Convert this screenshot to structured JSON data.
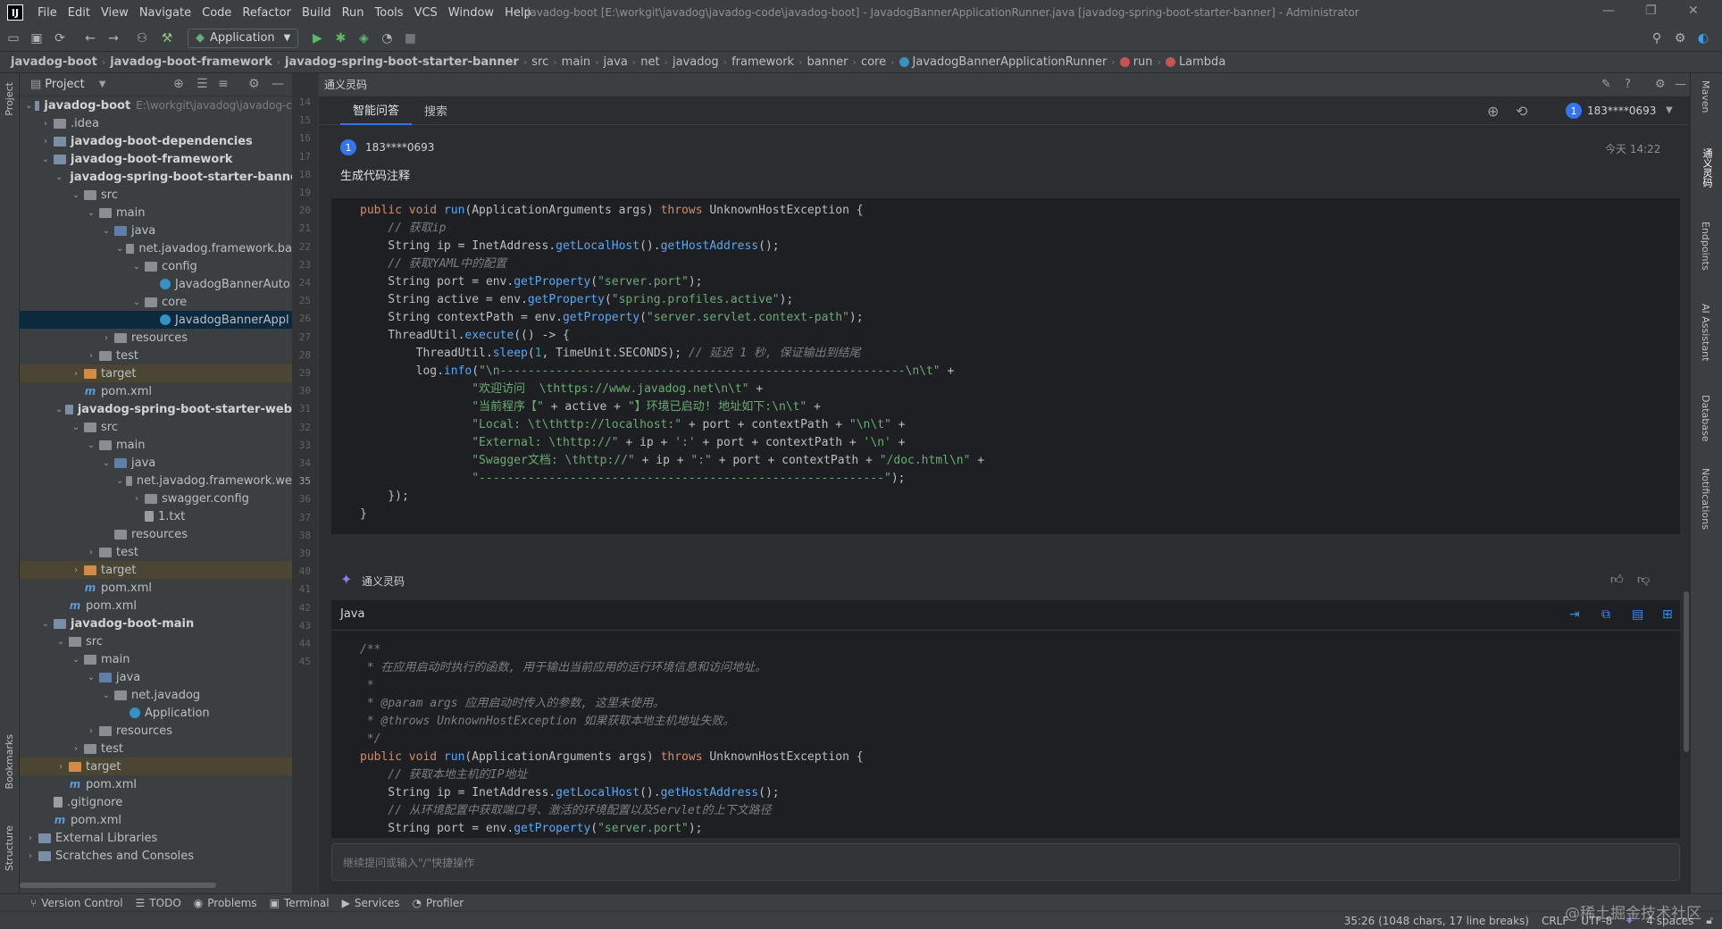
{
  "menubar": {
    "items": [
      "File",
      "Edit",
      "View",
      "Navigate",
      "Code",
      "Refactor",
      "Build",
      "Run",
      "Tools",
      "VCS",
      "Window",
      "Help"
    ],
    "title": "javadog-boot [E:\\workgit\\javadog\\javadog-code\\javadog-boot] - JavadogBannerApplicationRunner.java [javadog-spring-boot-starter-banner] - Administrator"
  },
  "toolbar": {
    "run_config": "Application"
  },
  "breadcrumb": [
    "javadog-boot",
    "javadog-boot-framework",
    "javadog-spring-boot-starter-banner",
    "src",
    "main",
    "java",
    "net",
    "javadog",
    "framework",
    "banner",
    "core",
    "JavadogBannerApplicationRunner",
    "run",
    "Lambda"
  ],
  "project_panel": {
    "title": "Project",
    "tree": [
      {
        "label": "javadog-boot",
        "hint": "E:\\workgit\\javadog\\javadog-c",
        "indent": 0,
        "arrow": "down",
        "icon": "mod",
        "bold": true
      },
      {
        "label": ".idea",
        "indent": 1,
        "arrow": "right",
        "icon": "folder"
      },
      {
        "label": "javadog-boot-dependencies",
        "indent": 1,
        "arrow": "right",
        "icon": "mod",
        "bold": true
      },
      {
        "label": "javadog-boot-framework",
        "indent": 1,
        "arrow": "down",
        "icon": "mod",
        "bold": true
      },
      {
        "label": "javadog-spring-boot-starter-banner",
        "indent": 2,
        "arrow": "down",
        "icon": "mod",
        "bold": true
      },
      {
        "label": "src",
        "indent": 3,
        "arrow": "down",
        "icon": "folder"
      },
      {
        "label": "main",
        "indent": 4,
        "arrow": "down",
        "icon": "folder"
      },
      {
        "label": "java",
        "indent": 5,
        "arrow": "down",
        "icon": "src"
      },
      {
        "label": "net.javadog.framework.ba",
        "indent": 6,
        "arrow": "down",
        "icon": "folder"
      },
      {
        "label": "config",
        "indent": 7,
        "arrow": "down",
        "icon": "folder"
      },
      {
        "label": "JavadogBannerAuto",
        "indent": 8,
        "arrow": "",
        "icon": "cls"
      },
      {
        "label": "core",
        "indent": 7,
        "arrow": "down",
        "icon": "folder"
      },
      {
        "label": "JavadogBannerAppl",
        "indent": 8,
        "arrow": "",
        "icon": "cls",
        "selected": true
      },
      {
        "label": "resources",
        "indent": 5,
        "arrow": "right",
        "icon": "res"
      },
      {
        "label": "test",
        "indent": 4,
        "arrow": "right",
        "icon": "folder"
      },
      {
        "label": "target",
        "indent": 3,
        "arrow": "right",
        "icon": "tgtf",
        "target": true
      },
      {
        "label": "pom.xml",
        "indent": 3,
        "arrow": "",
        "icon": "pom"
      },
      {
        "label": "javadog-spring-boot-starter-web",
        "indent": 2,
        "arrow": "down",
        "icon": "mod",
        "bold": true
      },
      {
        "label": "src",
        "indent": 3,
        "arrow": "down",
        "icon": "folder"
      },
      {
        "label": "main",
        "indent": 4,
        "arrow": "down",
        "icon": "folder"
      },
      {
        "label": "java",
        "indent": 5,
        "arrow": "down",
        "icon": "src"
      },
      {
        "label": "net.javadog.framework.we",
        "indent": 6,
        "arrow": "down",
        "icon": "folder"
      },
      {
        "label": "swagger.config",
        "indent": 7,
        "arrow": "right",
        "icon": "folder"
      },
      {
        "label": "1.txt",
        "indent": 7,
        "arrow": "",
        "icon": "txt"
      },
      {
        "label": "resources",
        "indent": 5,
        "arrow": "",
        "icon": "res"
      },
      {
        "label": "test",
        "indent": 4,
        "arrow": "right",
        "icon": "folder"
      },
      {
        "label": "target",
        "indent": 3,
        "arrow": "right",
        "icon": "tgtf",
        "target": true
      },
      {
        "label": "pom.xml",
        "indent": 3,
        "arrow": "",
        "icon": "pom"
      },
      {
        "label": "pom.xml",
        "indent": 2,
        "arrow": "",
        "icon": "pom"
      },
      {
        "label": "javadog-boot-main",
        "indent": 1,
        "arrow": "down",
        "icon": "mod",
        "bold": true
      },
      {
        "label": "src",
        "indent": 2,
        "arrow": "down",
        "icon": "folder"
      },
      {
        "label": "main",
        "indent": 3,
        "arrow": "down",
        "icon": "folder"
      },
      {
        "label": "java",
        "indent": 4,
        "arrow": "down",
        "icon": "src"
      },
      {
        "label": "net.javadog",
        "indent": 5,
        "arrow": "down",
        "icon": "folder"
      },
      {
        "label": "Application",
        "indent": 6,
        "arrow": "",
        "icon": "cls"
      },
      {
        "label": "resources",
        "indent": 4,
        "arrow": "right",
        "icon": "res"
      },
      {
        "label": "test",
        "indent": 3,
        "arrow": "right",
        "icon": "folder"
      },
      {
        "label": "target",
        "indent": 2,
        "arrow": "right",
        "icon": "tgtf",
        "target": true
      },
      {
        "label": "pom.xml",
        "indent": 2,
        "arrow": "",
        "icon": "pom"
      },
      {
        "label": ".gitignore",
        "indent": 1,
        "arrow": "",
        "icon": "txt"
      },
      {
        "label": "pom.xml",
        "indent": 1,
        "arrow": "",
        "icon": "pom"
      },
      {
        "label": "External Libraries",
        "indent": 0,
        "arrow": "right",
        "icon": "lib"
      },
      {
        "label": "Scratches and Consoles",
        "indent": 0,
        "arrow": "right",
        "icon": "lib"
      }
    ]
  },
  "gutter": {
    "lines": [
      "14",
      "15",
      "16",
      "17",
      "18",
      "19",
      "20",
      "21",
      "22",
      "23",
      "24",
      "25",
      "26",
      "27",
      "28",
      "29",
      "30",
      "31",
      "32",
      "33",
      "34",
      "35",
      "36",
      "37",
      "38",
      "39",
      "40",
      "41",
      "42",
      "43",
      "44",
      "45"
    ],
    "current": "35"
  },
  "left_vertical_tabs": [
    "Project",
    "Bookmarks",
    "Structure"
  ],
  "right_vertical_tabs": [
    "Maven",
    "通义灵码",
    "Endpoints",
    "AI Assistant",
    "Database",
    "Notifications"
  ],
  "tongyi": {
    "panel_title": "通义灵码",
    "tabs": [
      "智能问答",
      "搜索"
    ],
    "user": "183****0693",
    "question": {
      "user": "183****0693",
      "time": "今天 14:22",
      "text": "生成代码注释"
    },
    "question_code": [
      [
        [
          "kw",
          "public void "
        ],
        [
          "fn",
          "run"
        ],
        [
          "",
          "(ApplicationArguments args) "
        ],
        [
          "kw",
          "throws "
        ],
        [
          "",
          "UnknownHostException {"
        ]
      ],
      [
        [
          "cm",
          "    // 获取ip"
        ]
      ],
      [
        [
          "",
          "    String ip = InetAddress."
        ],
        [
          "fn",
          "getLocalHost"
        ],
        [
          "",
          "()."
        ],
        [
          "fn",
          "getHostAddress"
        ],
        [
          "",
          "();"
        ]
      ],
      [
        [
          "cm",
          "    // 获取YAML中的配置"
        ]
      ],
      [
        [
          "",
          "    String port = env."
        ],
        [
          "fn",
          "getProperty"
        ],
        [
          "",
          "("
        ],
        [
          "str",
          "\"server.port\""
        ],
        [
          "",
          ");"
        ]
      ],
      [
        [
          "",
          "    String active = env."
        ],
        [
          "fn",
          "getProperty"
        ],
        [
          "",
          "("
        ],
        [
          "str",
          "\"spring.profiles.active\""
        ],
        [
          "",
          ");"
        ]
      ],
      [
        [
          "",
          "    String contextPath = env."
        ],
        [
          "fn",
          "getProperty"
        ],
        [
          "",
          "("
        ],
        [
          "str",
          "\"server.servlet.context-path\""
        ],
        [
          "",
          ");"
        ]
      ],
      [
        [
          "",
          "    ThreadUtil."
        ],
        [
          "fn",
          "execute"
        ],
        [
          "",
          "(() -> {"
        ]
      ],
      [
        [
          "",
          "        ThreadUtil."
        ],
        [
          "fn",
          "sleep"
        ],
        [
          "",
          "("
        ],
        [
          "num",
          "1"
        ],
        [
          "",
          ", TimeUnit.SECONDS); "
        ],
        [
          "cm",
          "// 延迟 1 秒, 保证输出到结尾"
        ]
      ],
      [
        [
          "",
          "        log."
        ],
        [
          "fn",
          "info"
        ],
        [
          "",
          "("
        ],
        [
          "str",
          "\"\\n----------------------------------------------------------\\n\\t\""
        ],
        [
          "",
          " +"
        ]
      ],
      [
        [
          "str",
          "                \"欢迎访问  \\thttps://www.javadog.net\\n\\t\""
        ],
        [
          "",
          " +"
        ]
      ],
      [
        [
          "str",
          "                \"当前程序【\""
        ],
        [
          "",
          " + active + "
        ],
        [
          "str",
          "\"】环境已启动! 地址如下:\\n\\t\""
        ],
        [
          "",
          " +"
        ]
      ],
      [
        [
          "str",
          "                \"Local: \\t\\thttp://localhost:\""
        ],
        [
          "",
          " + port + contextPath + "
        ],
        [
          "str",
          "\"\\n\\t\""
        ],
        [
          "",
          " +"
        ]
      ],
      [
        [
          "str",
          "                \"External: \\thttp://\""
        ],
        [
          "",
          " + ip + "
        ],
        [
          "str",
          "':'"
        ],
        [
          "",
          " + port + contextPath + "
        ],
        [
          "str",
          "'\\n'"
        ],
        [
          "",
          " +"
        ]
      ],
      [
        [
          "str",
          "                \"Swagger文档: \\thttp://\""
        ],
        [
          "",
          " + ip + "
        ],
        [
          "str",
          "\":\""
        ],
        [
          "",
          " + port + contextPath + "
        ],
        [
          "str",
          "\"/doc.html\\n\""
        ],
        [
          "",
          " +"
        ]
      ],
      [
        [
          "str",
          "                \"----------------------------------------------------------\""
        ],
        [
          "",
          ");"
        ]
      ],
      [
        [
          "",
          "    });"
        ]
      ],
      [
        [
          "",
          "}"
        ]
      ]
    ],
    "answer": {
      "author": "通义灵码",
      "lang": "Java"
    },
    "answer_code": [
      [
        [
          "cm",
          "/**"
        ]
      ],
      [
        [
          "cm",
          " * 在应用启动时执行的函数, 用于输出当前应用的运行环境信息和访问地址。"
        ]
      ],
      [
        [
          "cm",
          " *"
        ]
      ],
      [
        [
          "cm",
          " * @param args 应用启动时传入的参数, 这里未使用。"
        ]
      ],
      [
        [
          "cm",
          " * @throws UnknownHostException 如果获取本地主机地址失败。"
        ]
      ],
      [
        [
          "cm",
          " */"
        ]
      ],
      [
        [
          "kw",
          "public void "
        ],
        [
          "fn",
          "run"
        ],
        [
          "",
          "(ApplicationArguments args) "
        ],
        [
          "kw",
          "throws "
        ],
        [
          "",
          "UnknownHostException {"
        ]
      ],
      [
        [
          "cm",
          "    // 获取本地主机的IP地址"
        ]
      ],
      [
        [
          "",
          "    String ip = InetAddress."
        ],
        [
          "fn",
          "getLocalHost"
        ],
        [
          "",
          "()."
        ],
        [
          "fn",
          "getHostAddress"
        ],
        [
          "",
          "();"
        ]
      ],
      [
        [
          "cm",
          "    // 从环境配置中获取端口号、激活的环境配置以及Servlet的上下文路径"
        ]
      ],
      [
        [
          "",
          "    String port = env."
        ],
        [
          "fn",
          "getProperty"
        ],
        [
          "",
          "("
        ],
        [
          "str",
          "\"server.port\""
        ],
        [
          "",
          ");"
        ]
      ]
    ],
    "input_placeholder": "继续提问或输入\"/\"快捷操作"
  },
  "bottom_tools": [
    "Version Control",
    "TODO",
    "Problems",
    "Terminal",
    "Services",
    "Profiler"
  ],
  "status": {
    "position": "35:26 (1048 chars, 17 line breaks)",
    "line_sep": "CRLF",
    "encoding": "UTF-8",
    "indent": "4 spaces"
  },
  "watermark": "@稀土掘金技术社区"
}
